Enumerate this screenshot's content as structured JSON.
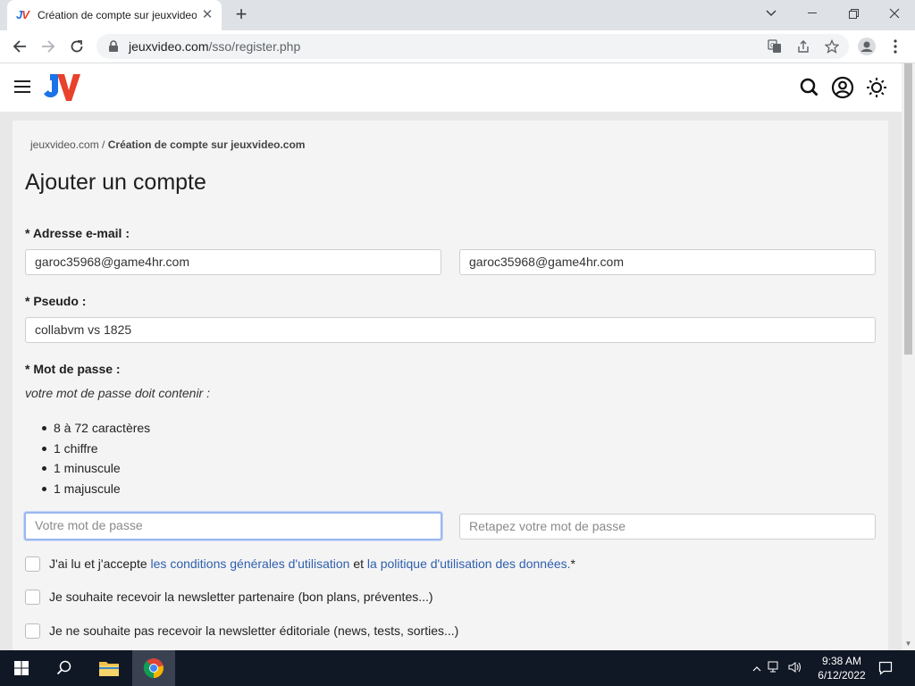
{
  "browser": {
    "tab": {
      "title": "Création de compte sur jeuxvideo.com",
      "favicon_j": "J",
      "favicon_v": "V"
    },
    "new_tab_symbol": "+",
    "window_controls": {
      "minimize": "—",
      "restore": "❐",
      "close": "✕",
      "tab_search": "⌄"
    },
    "url_host": "jeuxvideo.com",
    "url_path": "/sso/register.php"
  },
  "site": {
    "header_icons": [
      "menu-icon",
      "search-icon",
      "account-icon",
      "theme-toggle-icon"
    ],
    "brand_colors": {
      "j": "#1a73e8",
      "v": "#e8412c"
    }
  },
  "breadcrumb": {
    "home": "jeuxvideo.com",
    "separator": " / ",
    "current": "Création de compte sur jeuxvideo.com"
  },
  "form": {
    "title": "Ajouter un compte",
    "email_label": "* Adresse e-mail :",
    "email_value": "garoc35968@game4hr.com",
    "email_confirm_value": "garoc35968@game4hr.com",
    "pseudo_label": "* Pseudo :",
    "pseudo_value": "collabvm vs 1825",
    "password_label": "* Mot de passe :",
    "password_hint": "votre mot de passe doit contenir :",
    "password_rules": [
      "8 à 72 caractères",
      "1 chiffre",
      "1 minuscule",
      "1 majuscule"
    ],
    "password_placeholder": "Votre mot de passe",
    "password_confirm_placeholder": "Retapez votre mot de passe",
    "terms_prefix": "J'ai lu et j'accepte ",
    "terms_link": "les conditions générales d'utilisation",
    "terms_and": " et ",
    "privacy_link": "la politique d'utilisation des données.",
    "terms_required": " *",
    "newsletter_partner": "Je souhaite recevoir la newsletter partenaire (bon plans, préventes...)",
    "newsletter_editorial_optout": "Je ne souhaite pas recevoir la newsletter éditoriale (news, tests, sorties...)"
  },
  "taskbar": {
    "time": "9:38 AM",
    "date": "6/12/2022"
  }
}
